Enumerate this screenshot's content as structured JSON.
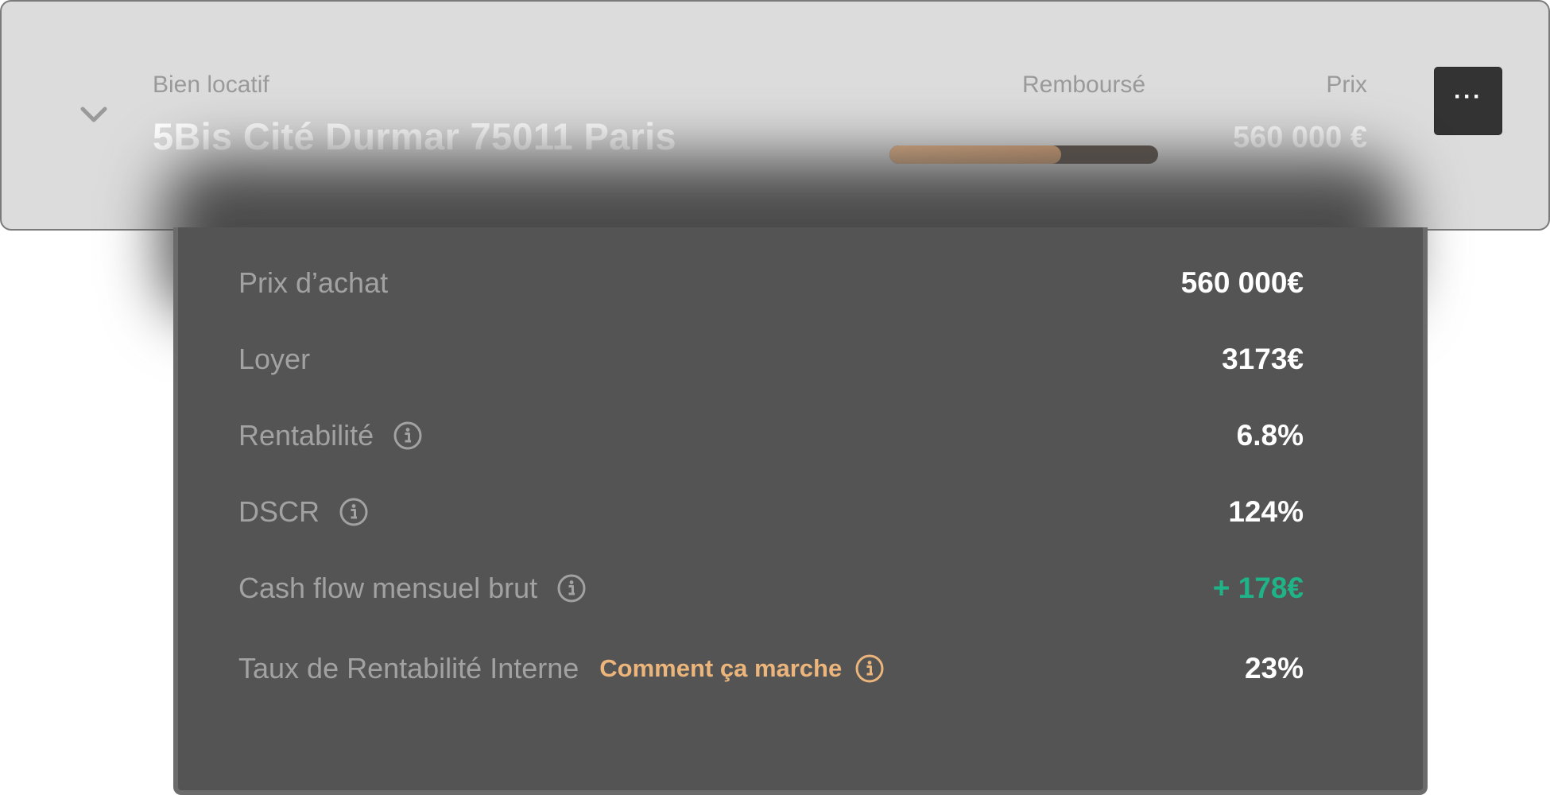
{
  "header": {
    "property_label": "Bien locatif",
    "property_name": "5Bis Cité Durmar 75011 Paris",
    "repaid_label": "Remboursé",
    "repaid_fraction": 0.64,
    "price_label": "Prix",
    "price_value": "560 000 €",
    "more_button": "···",
    "icons": {
      "expand": "chevron-down-icon",
      "more": "more-horizontal-icon"
    }
  },
  "details": {
    "rows": [
      {
        "label": "Prix d’achat",
        "value": "560 000€"
      },
      {
        "label": "Loyer",
        "value": "3173€"
      },
      {
        "label": "Rentabilité",
        "value": "6.8%"
      },
      {
        "label": "DSCR",
        "value": "124%"
      },
      {
        "label": "Cash flow mensuel brut",
        "value": "+ 178€"
      },
      {
        "label": "Taux de Rentabilité Interne",
        "value": "23%",
        "link": "Comment ça marche"
      }
    ]
  },
  "colors": {
    "card_bg": "#dcdcdc",
    "panel_bg": "#545454",
    "accent_orange": "#ecb57b",
    "positive_green": "#1fb488",
    "progress_fill": "#e0aa7b",
    "progress_track": "#574c44"
  }
}
